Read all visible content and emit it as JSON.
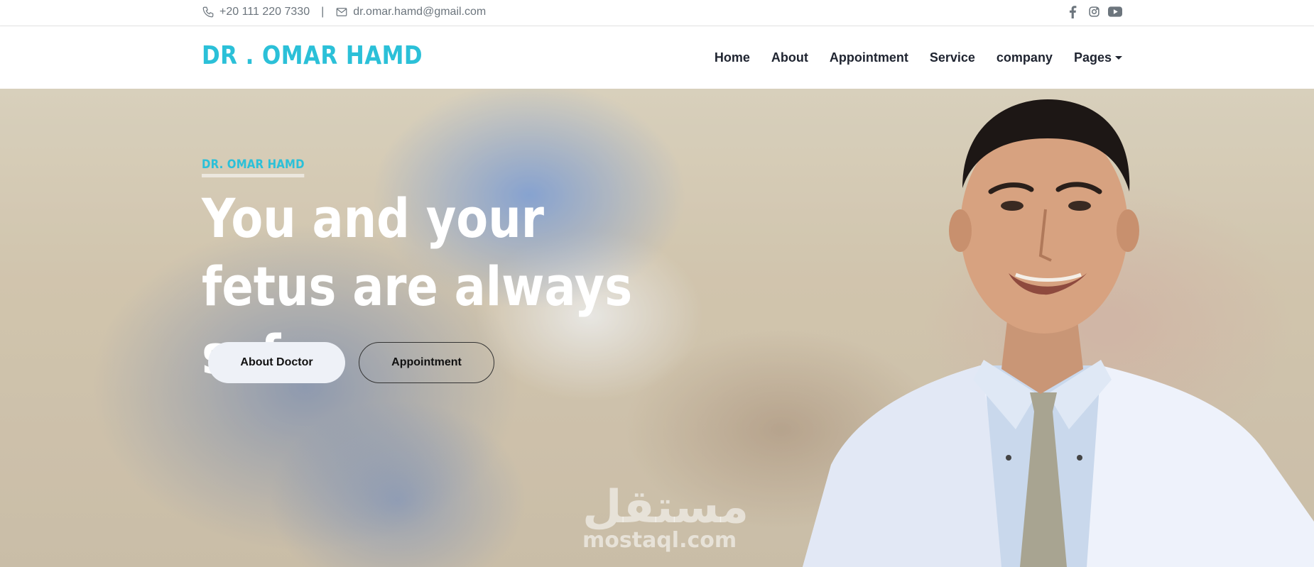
{
  "topbar": {
    "phone": "+20 111 220 7330",
    "separator": "|",
    "email": "dr.omar.hamd@gmail.com",
    "social": [
      "facebook-icon",
      "instagram-icon",
      "youtube-icon"
    ]
  },
  "navbar": {
    "logo": "DR . OMAR HAMD",
    "items": [
      {
        "label": "Home"
      },
      {
        "label": "About"
      },
      {
        "label": "Appointment"
      },
      {
        "label": "Service"
      },
      {
        "label": "company"
      },
      {
        "label": "Pages"
      }
    ]
  },
  "hero": {
    "eyebrow": "DR. OMAR HAMD",
    "headline": "You and your fetus are always safe",
    "primary_button": "About Doctor",
    "secondary_button": "Appointment"
  },
  "watermark": {
    "arabic": "مستقل",
    "latin": "mostaql.com"
  },
  "colors": {
    "accent": "#2bc0d8",
    "nav_text": "#1f2430",
    "muted": "#6c757d"
  }
}
